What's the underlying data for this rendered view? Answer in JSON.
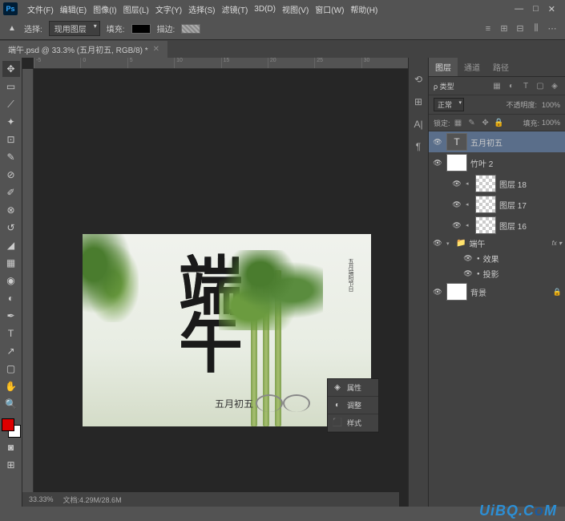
{
  "app": {
    "name": "Ps"
  },
  "menu": [
    "文件(F)",
    "编辑(E)",
    "图像(I)",
    "图层(L)",
    "文字(Y)",
    "选择(S)",
    "滤镜(T)",
    "3D(D)",
    "视图(V)",
    "窗口(W)",
    "帮助(H)"
  ],
  "window_controls": [
    "—",
    "□",
    "✕"
  ],
  "options": {
    "select_label": "选择:",
    "select_value": "现用图层",
    "fill_label": "填充:",
    "stroke_label": "描边:"
  },
  "document": {
    "tab_title": "端午.psd @ 33.3% (五月初五, RGB/8) *",
    "zoom": "33.33%",
    "doc_info": "文档:4.29M/28.6M"
  },
  "ruler_ticks": [
    "-5",
    "0",
    "5",
    "10",
    "15",
    "20",
    "25",
    "30"
  ],
  "canvas": {
    "char1": "端",
    "char2": "午",
    "subtitle": "五月初五",
    "vert_text": "五月端阳节日"
  },
  "float_panel": [
    {
      "icon": "◈",
      "label": "属性"
    },
    {
      "icon": "◐",
      "label": "调整"
    },
    {
      "icon": "⬛",
      "label": "样式"
    }
  ],
  "panel_tabs": [
    "图层",
    "通道",
    "路径"
  ],
  "layer_opts": {
    "kind": "ρ 类型",
    "blend": "正常",
    "opacity_label": "不透明度:",
    "opacity": "100%",
    "lock_label": "锁定:",
    "fill_label": "填充:",
    "fill": "100%"
  },
  "layers": [
    {
      "vis": true,
      "type": "text",
      "name": "五月初五",
      "selected": true
    },
    {
      "vis": true,
      "type": "img",
      "name": "竹叶 2"
    },
    {
      "vis": true,
      "type": "trans",
      "name": "图层 18",
      "sub": true
    },
    {
      "vis": true,
      "type": "trans",
      "name": "图层 17",
      "sub": true
    },
    {
      "vis": true,
      "type": "trans",
      "name": "图层 16",
      "sub": true
    },
    {
      "vis": true,
      "type": "group",
      "name": "端午",
      "fx": true
    },
    {
      "vis": true,
      "type": "fx",
      "name": "效果",
      "sub2": true
    },
    {
      "vis": true,
      "type": "fx",
      "name": "投影",
      "sub2": true
    },
    {
      "vis": true,
      "type": "bg",
      "name": "背景",
      "locked": true
    }
  ],
  "watermark": "UiBQ.CoM"
}
